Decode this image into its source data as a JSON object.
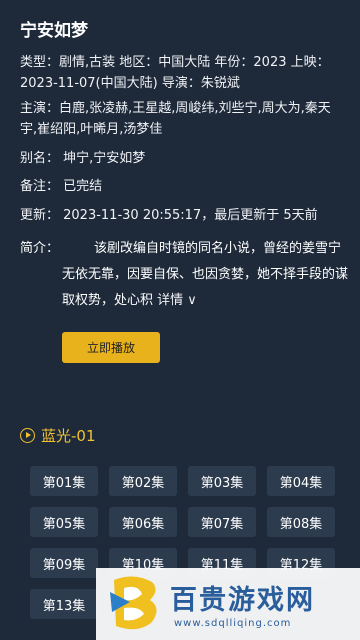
{
  "title": "宁安如梦",
  "info": {
    "type_line": "类型：剧情,古装   地区：中国大陆   年份：2023   上映：2023-11-07(中国大陆)   导演：朱锐斌",
    "cast_line": "主演：白鹿,张凌赫,王星越,周峻纬,刘些宁,周大为,秦天宇,崔绍阳,叶晞月,汤梦佳",
    "alias_line": "别名：   坤宁,宁安如梦",
    "note_line": "备注：   已完结",
    "update_line": "更新：   2023-11-30 20:55:17，最后更新于 5天前"
  },
  "synopsis": {
    "label": "简介：",
    "text": "该剧改编自时镜的同名小说，曾经的姜雪宁无依无靠，因要自保、也因贪婪，她不择手段的谋取权势，处心积",
    "more": " 详情 ∨"
  },
  "play_button": "立即播放",
  "source": {
    "label": "蓝光-01",
    "icon": "play-circle-icon",
    "color": "#f3c22c"
  },
  "episodes": [
    "第01集",
    "第02集",
    "第03集",
    "第04集",
    "第05集",
    "第06集",
    "第07集",
    "第08集",
    "第09集",
    "第10集",
    "第11集",
    "第12集",
    "第13集"
  ],
  "watermark": {
    "cn": "百贵游戏网",
    "en": "www.sdqlliqing.com"
  }
}
